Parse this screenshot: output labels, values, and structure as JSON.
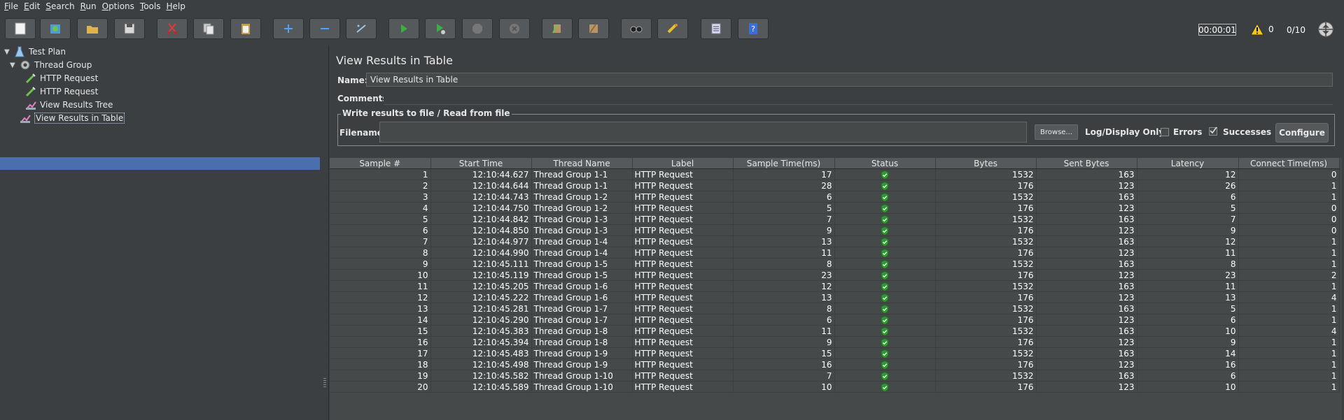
{
  "menu": [
    {
      "label": "File",
      "key": "F",
      "rest": "ile"
    },
    {
      "label": "Edit",
      "key": "E",
      "rest": "dit"
    },
    {
      "label": "Search",
      "key": "S",
      "rest": "earch"
    },
    {
      "label": "Run",
      "key": "R",
      "rest": "un"
    },
    {
      "label": "Options",
      "key": "O",
      "rest": "ptions"
    },
    {
      "label": "Tools",
      "key": "T",
      "rest": "ools"
    },
    {
      "label": "Help",
      "key": "H",
      "rest": "elp"
    }
  ],
  "toolbar": {
    "buttons": [
      "new-icon",
      "templates-icon",
      "open-icon",
      "save-icon",
      "cut-icon",
      "copy-icon",
      "paste-icon",
      "expand-icon",
      "collapse-icon",
      "toggle-icon",
      "start-icon",
      "start-no-pauses-icon",
      "stop-icon",
      "shutdown-icon",
      "clear-icon",
      "clear-all-icon",
      "search-icon",
      "reset-search-icon",
      "function-helper-icon",
      "help-icon"
    ],
    "timer": "00:00:01",
    "warnings": "0",
    "threads": "0/10"
  },
  "tree": {
    "items": [
      {
        "label": "Test Plan"
      },
      {
        "label": "Thread Group"
      },
      {
        "label": "HTTP Request"
      },
      {
        "label": "HTTP Request"
      },
      {
        "label": "View Results Tree"
      },
      {
        "label": "View Results in Table"
      }
    ]
  },
  "panel": {
    "title": "View Results in Table",
    "name_label": "Name:",
    "name_value": "View Results in Table",
    "comments_label": "Comments:",
    "fieldset_legend": "Write results to file / Read from file",
    "filename_label": "Filename",
    "browse_label": "Browse...",
    "log_label": "Log/Display Only:",
    "errors_label": "Errors",
    "errors_checked": false,
    "successes_label": "Successes",
    "successes_checked": true,
    "configure_label": "Configure"
  },
  "table": {
    "columns": [
      "Sample #",
      "Start Time",
      "Thread Name",
      "Label",
      "Sample Time(ms)",
      "Status",
      "Bytes",
      "Sent Bytes",
      "Latency",
      "Connect Time(ms)"
    ],
    "status_icon": "success-shield-icon",
    "rows": [
      [
        "1",
        "12:10:44.627",
        "Thread Group 1-1",
        "HTTP Request",
        "17",
        "1532",
        "163",
        "12",
        "0"
      ],
      [
        "2",
        "12:10:44.644",
        "Thread Group 1-1",
        "HTTP Request",
        "28",
        "176",
        "123",
        "26",
        "1"
      ],
      [
        "3",
        "12:10:44.743",
        "Thread Group 1-2",
        "HTTP Request",
        "6",
        "1532",
        "163",
        "6",
        "1"
      ],
      [
        "4",
        "12:10:44.750",
        "Thread Group 1-2",
        "HTTP Request",
        "5",
        "176",
        "123",
        "5",
        "0"
      ],
      [
        "5",
        "12:10:44.842",
        "Thread Group 1-3",
        "HTTP Request",
        "7",
        "1532",
        "163",
        "7",
        "0"
      ],
      [
        "6",
        "12:10:44.850",
        "Thread Group 1-3",
        "HTTP Request",
        "9",
        "176",
        "123",
        "9",
        "0"
      ],
      [
        "7",
        "12:10:44.977",
        "Thread Group 1-4",
        "HTTP Request",
        "13",
        "1532",
        "163",
        "12",
        "1"
      ],
      [
        "8",
        "12:10:44.990",
        "Thread Group 1-4",
        "HTTP Request",
        "11",
        "176",
        "123",
        "11",
        "1"
      ],
      [
        "9",
        "12:10:45.111",
        "Thread Group 1-5",
        "HTTP Request",
        "8",
        "1532",
        "163",
        "8",
        "1"
      ],
      [
        "10",
        "12:10:45.119",
        "Thread Group 1-5",
        "HTTP Request",
        "23",
        "176",
        "123",
        "23",
        "2"
      ],
      [
        "11",
        "12:10:45.205",
        "Thread Group 1-6",
        "HTTP Request",
        "12",
        "1532",
        "163",
        "11",
        "1"
      ],
      [
        "12",
        "12:10:45.222",
        "Thread Group 1-6",
        "HTTP Request",
        "13",
        "176",
        "123",
        "13",
        "4"
      ],
      [
        "13",
        "12:10:45.281",
        "Thread Group 1-7",
        "HTTP Request",
        "8",
        "1532",
        "163",
        "5",
        "1"
      ],
      [
        "14",
        "12:10:45.290",
        "Thread Group 1-7",
        "HTTP Request",
        "6",
        "176",
        "123",
        "6",
        "1"
      ],
      [
        "15",
        "12:10:45.383",
        "Thread Group 1-8",
        "HTTP Request",
        "11",
        "1532",
        "163",
        "10",
        "4"
      ],
      [
        "16",
        "12:10:45.394",
        "Thread Group 1-8",
        "HTTP Request",
        "9",
        "176",
        "123",
        "9",
        "1"
      ],
      [
        "17",
        "12:10:45.483",
        "Thread Group 1-9",
        "HTTP Request",
        "15",
        "1532",
        "163",
        "14",
        "1"
      ],
      [
        "18",
        "12:10:45.498",
        "Thread Group 1-9",
        "HTTP Request",
        "16",
        "176",
        "123",
        "16",
        "1"
      ],
      [
        "19",
        "12:10:45.582",
        "Thread Group 1-10",
        "HTTP Request",
        "7",
        "1532",
        "163",
        "6",
        "1"
      ],
      [
        "20",
        "12:10:45.589",
        "Thread Group 1-10",
        "HTTP Request",
        "10",
        "176",
        "123",
        "10",
        "1"
      ]
    ]
  },
  "colors": {
    "background": "#3c3f41",
    "selection": "#4b6eaf",
    "success": "#2e9a2e"
  }
}
